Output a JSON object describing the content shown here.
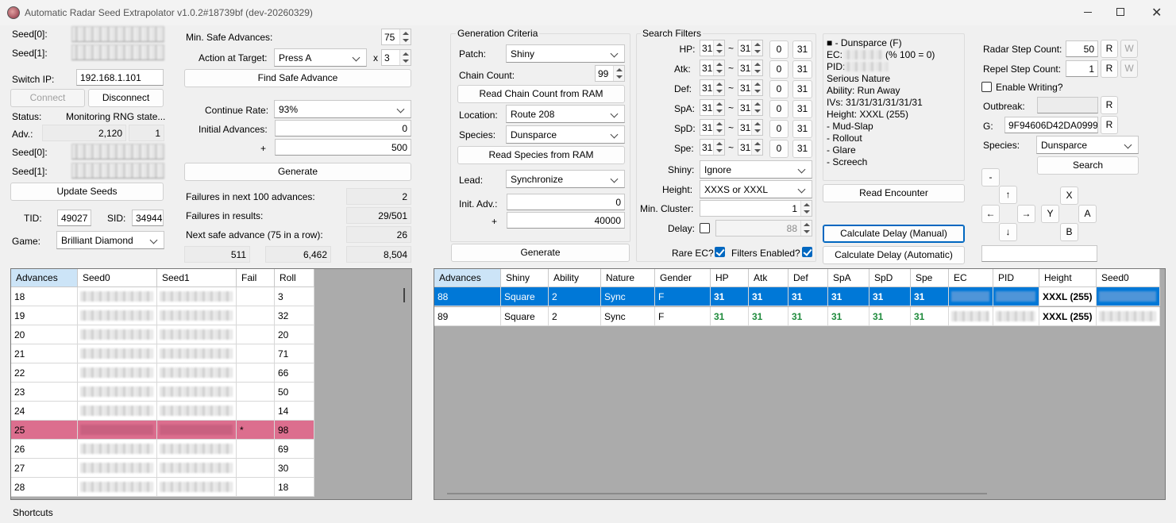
{
  "window": {
    "title": "Automatic Radar Seed Extrapolator v1.0.2#18739bf (dev-20260329)"
  },
  "left": {
    "seed0_label": "Seed[0]:",
    "seed1_label": "Seed[1]:",
    "switch_ip_label": "Switch IP:",
    "switch_ip": "192.168.1.101",
    "connect": "Connect",
    "disconnect": "Disconnect",
    "status_label": "Status:",
    "status": "Monitoring RNG state...",
    "adv_label": "Adv.:",
    "adv": "2,120",
    "adv2": "1",
    "seed0b_label": "Seed[0]:",
    "seed1b_label": "Seed[1]:",
    "update_seeds": "Update Seeds",
    "tid_label": "TID:",
    "tid": "49027",
    "sid_label": "SID:",
    "sid": "34944",
    "game_label": "Game:",
    "game": "Brilliant Diamond"
  },
  "safe": {
    "min_safe_label": "Min. Safe Advances:",
    "min_safe": "75",
    "action_label": "Action at Target:",
    "action": "Press A",
    "x": "x",
    "times": "3",
    "find_safe": "Find Safe Advance",
    "continue_label": "Continue Rate:",
    "continue": "93%",
    "init_adv_label": "Initial Advances:",
    "init_adv": "0",
    "plus": "+",
    "plus_val": "500",
    "generate": "Generate",
    "fail100_label": "Failures in next 100 advances:",
    "fail100": "2",
    "failres_label": "Failures in results:",
    "failres": "29/501",
    "next_label": "Next safe advance (75 in a row):",
    "next": "26",
    "v1": "511",
    "v2": "6,462",
    "v3": "8,504"
  },
  "gen": {
    "title": "Generation Criteria",
    "patch_label": "Patch:",
    "patch": "Shiny",
    "chain_label": "Chain Count:",
    "chain": "99",
    "read_chain": "Read Chain Count from RAM",
    "location_label": "Location:",
    "location": "Route 208",
    "species_label": "Species:",
    "species": "Dunsparce",
    "read_species": "Read Species from RAM",
    "lead_label": "Lead:",
    "lead": "Synchronize",
    "init_label": "Init. Adv.:",
    "init": "0",
    "plus": "+",
    "plus_val": "40000",
    "generate": "Generate"
  },
  "filters": {
    "title": "Search Filters",
    "stats": [
      {
        "label": "HP:",
        "min": "31",
        "max": "31",
        "a": "0",
        "b": "31"
      },
      {
        "label": "Atk:",
        "min": "31",
        "max": "31",
        "a": "0",
        "b": "31"
      },
      {
        "label": "Def:",
        "min": "31",
        "max": "31",
        "a": "0",
        "b": "31"
      },
      {
        "label": "SpA:",
        "min": "31",
        "max": "31",
        "a": "0",
        "b": "31"
      },
      {
        "label": "SpD:",
        "min": "31",
        "max": "31",
        "a": "0",
        "b": "31"
      },
      {
        "label": "Spe:",
        "min": "31",
        "max": "31",
        "a": "0",
        "b": "31"
      }
    ],
    "tilde": "~",
    "shiny_label": "Shiny:",
    "shiny": "Ignore",
    "height_label": "Height:",
    "height": "XXXS or XXXL",
    "cluster_label": "Min. Cluster:",
    "cluster": "1",
    "delay_label": "Delay:",
    "delay": "88",
    "rare_label": "Rare EC?",
    "enabled_label": "Filters Enabled?"
  },
  "encounter": {
    "lines": [
      "■ - Dunsparce (F)",
      "EC:",
      "PID:",
      "Serious Nature",
      "Ability: Run Away",
      "IVs: 31/31/31/31/31/31",
      "Height: XXXL (255)",
      "- Mud-Slap",
      "- Rollout",
      "- Glare",
      "- Screech"
    ],
    "ec_suffix": "(% 100 = 0)",
    "read": "Read Encounter",
    "calc_manual": "Calculate Delay (Manual)",
    "calc_auto": "Calculate Delay (Automatic)"
  },
  "radar": {
    "step_label": "Radar Step Count:",
    "step": "50",
    "repel_label": "Repel Step Count:",
    "repel": "1",
    "r": "R",
    "w": "W",
    "enable_label": "Enable Writing?",
    "outbreak_label": "Outbreak:",
    "g_label": "G:",
    "g": "9F94606D42DA0999",
    "species_label": "Species:",
    "species": "Dunsparce",
    "search": "Search",
    "dash": "-",
    "up": "↑",
    "left": "←",
    "right": "→",
    "down": "↓",
    "X": "X",
    "Y": "Y",
    "A": "A",
    "B": "B"
  },
  "table1": {
    "headers": [
      "Advances",
      "Seed0",
      "Seed1",
      "Fail",
      "Roll"
    ],
    "rows": [
      {
        "adv": "18",
        "fail": "",
        "roll": "3"
      },
      {
        "adv": "19",
        "fail": "",
        "roll": "32"
      },
      {
        "adv": "20",
        "fail": "",
        "roll": "20"
      },
      {
        "adv": "21",
        "fail": "",
        "roll": "71"
      },
      {
        "adv": "22",
        "fail": "",
        "roll": "66"
      },
      {
        "adv": "23",
        "fail": "",
        "roll": "50"
      },
      {
        "adv": "24",
        "fail": "",
        "roll": "14"
      },
      {
        "adv": "25",
        "fail": "*",
        "roll": "98"
      },
      {
        "adv": "26",
        "fail": "",
        "roll": "69"
      },
      {
        "adv": "27",
        "fail": "",
        "roll": "30"
      },
      {
        "adv": "28",
        "fail": "",
        "roll": "18"
      }
    ]
  },
  "table2": {
    "headers": [
      "Advances",
      "Shiny",
      "Ability",
      "Nature",
      "Gender",
      "HP",
      "Atk",
      "Def",
      "SpA",
      "SpD",
      "Spe",
      "EC",
      "PID",
      "Height",
      "Seed0"
    ],
    "rows": [
      {
        "adv": "88",
        "shiny": "Square",
        "ability": "2",
        "nature": "Sync",
        "gender": "F",
        "ivs": [
          "31",
          "31",
          "31",
          "31",
          "31",
          "31"
        ],
        "height": "XXXL (255)"
      },
      {
        "adv": "89",
        "shiny": "Square",
        "ability": "2",
        "nature": "Sync",
        "gender": "F",
        "ivs": [
          "31",
          "31",
          "31",
          "31",
          "31",
          "31"
        ],
        "height": "XXXL (255)"
      }
    ]
  },
  "status_bar": {
    "shortcuts": "Shortcuts"
  }
}
